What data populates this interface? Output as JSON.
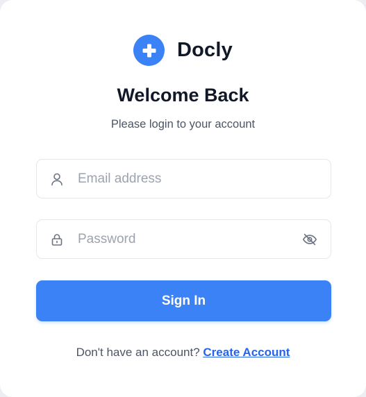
{
  "brand": {
    "name": "Docly",
    "logo_icon": "plus-icon",
    "accent_color": "#3b82f6"
  },
  "header": {
    "title": "Welcome Back",
    "subtitle": "Please login to your account"
  },
  "form": {
    "email": {
      "placeholder": "Email address",
      "value": "",
      "icon": "user-icon"
    },
    "password": {
      "placeholder": "Password",
      "value": "",
      "icon": "lock-icon",
      "toggle_icon": "eye-off-icon"
    },
    "submit_label": "Sign In"
  },
  "footer": {
    "prompt": "Don't have an account?",
    "link_label": "Create Account",
    "link_color": "#2563eb"
  }
}
